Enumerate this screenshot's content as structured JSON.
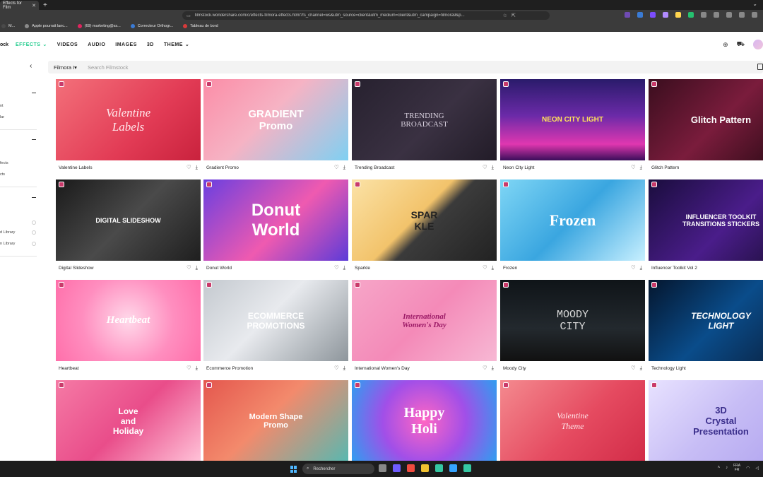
{
  "browser": {
    "tab_title": "Effects for Film",
    "url": "filmstock.wondershare.com/c/effects-filmora-effects.html?fs_channel=ws&utm_source=client&utm_medium=client&utm_campaign=filmora9&p...",
    "bookmarks": [
      {
        "label": "M...",
        "color": "#4a4a4a"
      },
      {
        "label": "Apple pourrait lanc...",
        "color": "#8a8a8a"
      },
      {
        "label": "(69) marketing@ss...",
        "color": "#e0245e"
      },
      {
        "label": "Correcteur Orthogr...",
        "color": "#3a7bd5"
      },
      {
        "label": "Tableau de bord",
        "color": "#d63a3a"
      }
    ],
    "extension_colors": [
      "#6f4bb3",
      "#3a7bd5",
      "#7c4dff",
      "#b28cff",
      "#ffd54f",
      "#25c16f",
      "#888888",
      "#888888",
      "#888888",
      "#888888",
      "#888888"
    ]
  },
  "header": {
    "logo_fragment": "ock",
    "nav": [
      {
        "label": "EFFECTS",
        "active": true,
        "caret": true
      },
      {
        "label": "VIDEOS",
        "active": false,
        "caret": false
      },
      {
        "label": "AUDIO",
        "active": false,
        "caret": false
      },
      {
        "label": "IMAGES",
        "active": false,
        "caret": false
      },
      {
        "label": "3D",
        "active": false,
        "caret": false
      },
      {
        "label": "THEME",
        "active": false,
        "caret": true
      }
    ],
    "icons": [
      "globe-icon",
      "cart-icon",
      "avatar"
    ]
  },
  "sidebar": {
    "items": [
      "nt",
      "lar",
      "fects",
      "cts",
      "d Library",
      "n Library"
    ]
  },
  "search": {
    "filter_label": "Filmora I",
    "placeholder": "Search Filmstock"
  },
  "cards": [
    {
      "title": "Valentine Labels",
      "thumb_text": "Valentine\nLabels",
      "bg": "linear-gradient(135deg,#f3707a,#e23b55 60%,#c9223d)",
      "fg": "#ffe8ec",
      "font": "italic 17px \"Liberation Serif\", serif"
    },
    {
      "title": "Gradient Promo",
      "thumb_text": "GRADIENT\nPromo",
      "bg": "linear-gradient(135deg,#fb8da7,#f6b3c4 45%,#7fd0f2)",
      "fg": "#ffffff",
      "font": "bold 15px \"Liberation Sans\", sans-serif"
    },
    {
      "title": "Trending Broadcast",
      "thumb_text": "TRENDING\nBROADCAST",
      "bg": "linear-gradient(135deg,#27212f,#3a3142 55%,#221c28)",
      "fg": "#d8d0de",
      "font": "11px \"Liberation Serif\", serif"
    },
    {
      "title": "Neon City Light",
      "thumb_text": "NEON CITY LIGHT",
      "bg": "linear-gradient(180deg,#2a1b6b,#6b2aa8 45%,#e037b0 80%,#3a0e5a)",
      "fg": "#ffe55a",
      "font": "bold 10px \"Liberation Sans\", sans-serif"
    },
    {
      "title": "Glitch Pattern",
      "thumb_text": "Glitch Pattern",
      "bg": "linear-gradient(135deg,#3a0e1e,#7a1c3c 50%,#2a0a15)",
      "fg": "#ffffff",
      "font": "bold 13px \"Liberation Sans\", sans-serif"
    },
    {
      "title": "Digital Slideshow",
      "thumb_text": "DIGITAL SLIDESHOW",
      "bg": "linear-gradient(135deg,#1a1a1a,#4a4a4a 50%,#1f1f1f)",
      "fg": "#ffffff",
      "font": "bold 9px \"Liberation Sans\", sans-serif"
    },
    {
      "title": "Donut World",
      "thumb_text": "Donut\nWorld",
      "bg": "linear-gradient(135deg,#6a3fe0,#ef5ab0 55%,#5c3bd8)",
      "fg": "#ffffff",
      "font": "bold 24px \"Liberation Sans\", sans-serif"
    },
    {
      "title": "Sparkle",
      "thumb_text": "SPAR\nKLE",
      "bg": "linear-gradient(135deg,#fbe2a6,#f2c36b 45%,#3b3b3b 55%,#222)",
      "fg": "#222222",
      "font": "bold 14px \"Liberation Sans\", sans-serif"
    },
    {
      "title": "Frozen",
      "thumb_text": "Frozen",
      "bg": "linear-gradient(135deg,#7fd6f5,#3aa6e0 50%,#c8f0ff)",
      "fg": "#ffffff",
      "font": "bold 22px \"Liberation Serif\", serif"
    },
    {
      "title": "Influencer Toolkit Vol 2",
      "thumb_text": "INFLUENCER TOOLKIT\nTRANSITIONS  STICKERS",
      "bg": "linear-gradient(135deg,#1a0d3d,#4a1d8a 55%,#1d0e3a)",
      "fg": "#ffffff",
      "font": "bold 9px \"Liberation Sans\", sans-serif"
    },
    {
      "title": "Heartbeat",
      "thumb_text": "Heartbeat",
      "bg": "radial-gradient(circle at 50% 50%,#ffd9ea,#ff8ebf 55%,#ff6faa)",
      "fg": "#ffffff",
      "font": "italic bold 15px \"Liberation Serif\", serif"
    },
    {
      "title": "Ecommerce Promotion",
      "thumb_text": "ECOMMERCE\nPROMOTIONS",
      "bg": "linear-gradient(135deg,#c4c9cf,#e8eaee 45%,#8e969c)",
      "fg": "#ffffff",
      "font": "bold 12px \"Liberation Sans\", sans-serif"
    },
    {
      "title": "International Women's Day",
      "thumb_text": "International\nWomen's Day",
      "bg": "linear-gradient(135deg,#f6a6c8,#f48ab8 50%,#f7b8d4)",
      "fg": "#9b1a66",
      "font": "italic bold 11px \"Liberation Serif\", serif"
    },
    {
      "title": "Moody City",
      "thumb_text": "MOODY\nCITY",
      "bg": "linear-gradient(180deg,#0f1418,#23292e 60%,#111)",
      "fg": "#d9d9d9",
      "font": "15px \"Liberation Mono\", monospace"
    },
    {
      "title": "Technology Light",
      "thumb_text": "TECHNOLOGY\nLIGHT",
      "bg": "linear-gradient(135deg,#04162e,#0a4c8a 50%,#0a2140)",
      "fg": "#ffffff",
      "font": "italic bold 12px \"Liberation Sans\", sans-serif"
    },
    {
      "title": "Love and Holiday",
      "thumb_text": "Love\nand\nHoliday",
      "bg": "linear-gradient(135deg,#f57aa5,#e94d8a 50%,#ffc2d8)",
      "fg": "#ffffff",
      "font": "bold 12px \"Liberation Sans\", sans-serif"
    },
    {
      "title": "Modern Shape Promo",
      "thumb_text": "Modern Shape\nPromo",
      "bg": "linear-gradient(135deg,#e4574e,#f38a6c 45%,#58b8b0)",
      "fg": "#ffffff",
      "font": "bold 11px \"Liberation Sans\", sans-serif"
    },
    {
      "title": "Happy Holi",
      "thumb_text": "Happy\nHoli",
      "bg": "radial-gradient(circle at 50% 50%,#ff66c4,#a14fe8 50%,#2f9ef0)",
      "fg": "#ffffff",
      "font": "bold 20px \"Liberation Serif\", serif"
    },
    {
      "title": "Valentine Theme",
      "thumb_text": "Valentine\nTheme",
      "bg": "linear-gradient(135deg,#f48a8f,#e54a60 55%,#d22c48)",
      "fg": "#ffe8ec",
      "font": "italic 12px \"Liberation Serif\", serif"
    },
    {
      "title": "3D Crystal Presentation",
      "thumb_text": "3D\nCrystal\nPresentation",
      "bg": "linear-gradient(135deg,#e8e2ff,#c7bdf5 50%,#b1a4f0)",
      "fg": "#3b2f8c",
      "font": "bold 13px \"Liberation Sans\", sans-serif"
    }
  ],
  "taskbar": {
    "search_placeholder": "Rechercher",
    "app_colors": [
      "#888888",
      "#6f5cff",
      "#f24b3f",
      "#f2c230",
      "#35c7a3",
      "#35a3ff",
      "#35c7a3"
    ],
    "lang_top": "FRA",
    "lang_bottom": "FR"
  }
}
